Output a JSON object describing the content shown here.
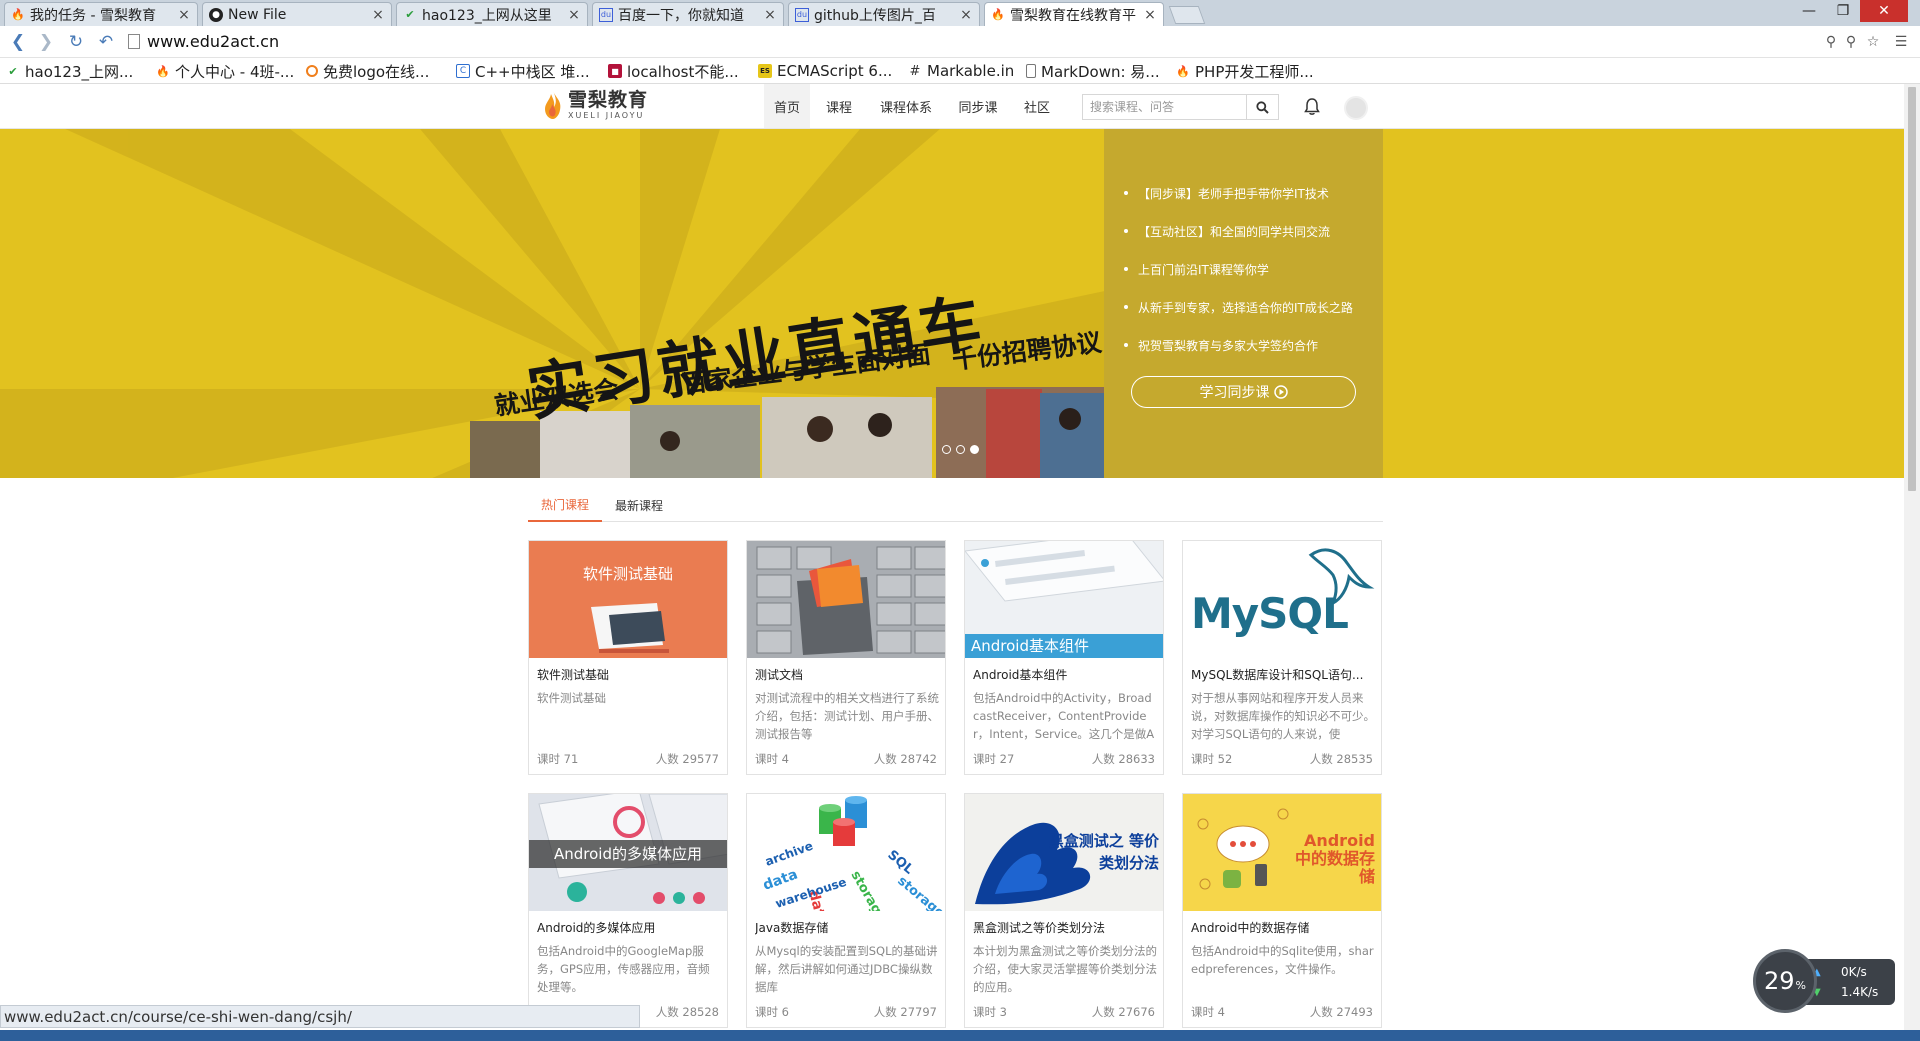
{
  "browser": {
    "tabs": [
      {
        "title": "我的任务 - 雪梨教育",
        "icon": "flame-icon"
      },
      {
        "title": "New File",
        "icon": "github-icon"
      },
      {
        "title": "hao123_上网从这里",
        "icon": "hao123-icon"
      },
      {
        "title": "百度一下，你就知道",
        "icon": "baidu-icon"
      },
      {
        "title": "github上传图片_百",
        "icon": "baidu-icon"
      },
      {
        "title": "雪梨教育在线教育平",
        "icon": "flame-icon"
      }
    ],
    "url": "www.edu2act.cn",
    "bookmarks": [
      {
        "label": "hao123_上网...",
        "icon": "hao123-icon",
        "color": "#2a9d3b"
      },
      {
        "label": "个人中心 - 4班-...",
        "icon": "flame-icon",
        "color": "#f08a1c"
      },
      {
        "label": "免费logo在线...",
        "icon": "logo-icon",
        "color": "#f07f1c"
      },
      {
        "label": "C++中栈区 堆...",
        "icon": "csdn-icon",
        "color": "#2f6fd0"
      },
      {
        "label": "localhost不能...",
        "icon": "stack-icon",
        "color": "#b3123a"
      },
      {
        "label": "ECMAScript 6...",
        "icon": "es-icon",
        "color": "#e6c619"
      },
      {
        "label": "Markable.in",
        "icon": "hash-icon",
        "color": "#333333"
      },
      {
        "label": "MarkDown: 易...",
        "icon": "page-icon",
        "color": "#777777"
      },
      {
        "label": "PHP开发工程师...",
        "icon": "flame-icon",
        "color": "#e0431c"
      }
    ],
    "status_url": "www.edu2act.cn/course/ce-shi-wen-dang/csjh/"
  },
  "site": {
    "logo_cn": "雪梨教育",
    "logo_en": "XUELI JIAOYU",
    "nav": [
      "首页",
      "课程",
      "课程体系",
      "同步课",
      "社区"
    ],
    "search_placeholder": "搜索课程、问答",
    "accent": "#e9673b"
  },
  "hero": {
    "headline": "实习就业直通车",
    "sub1": "就业双选会",
    "sub2": "百家企业与学生面对面",
    "sub3": "千份招聘协议",
    "list": [
      "【同步课】老师手把手带你学IT技术",
      "【互动社区】和全国的同学共同交流",
      "上百门前沿IT课程等你学",
      "从新手到专家，选择适合你的IT成长之路",
      "祝贺雪梨教育与多家大学签约合作"
    ],
    "button": "学习同步课",
    "bg_color": "#e2c21f",
    "panel_color": "#c5a92e"
  },
  "tabs": [
    "热门课程",
    "最新课程"
  ],
  "courses": [
    {
      "title": "软件测试基础",
      "desc": "软件测试基础",
      "lessons": "课时 71",
      "users": "人数 29577",
      "thumb_text": "软件测试基础"
    },
    {
      "title": "测试文档",
      "desc": "对测试流程中的相关文档进行了系统介绍，包括：测试计划、用户手册、测试报告等",
      "lessons": "课时 4",
      "users": "人数 28742",
      "thumb_text": ""
    },
    {
      "title": "Android基本组件",
      "desc": "包括Android中的Activity，BroadcastReceiver，ContentProvider，Intent，Service。这几个是做Andr",
      "lessons": "课时 27",
      "users": "人数 28633",
      "thumb_text": "Android基本组件"
    },
    {
      "title": "MySQL数据库设计和SQL语句...",
      "desc": "对于想从事网站和程序开发人员来说，对数据库操作的知识必不可少。对学习SQL语句的人来说，使",
      "lessons": "课时 52",
      "users": "人数 28535",
      "thumb_text": "MySQL"
    },
    {
      "title": "Android的多媒体应用",
      "desc": "包括Android中的GoogleMap服务，GPS应用，传感器应用，音频处理等。",
      "lessons": "",
      "users": "人数 28528",
      "thumb_text": "Android的多媒体应用"
    },
    {
      "title": "Java数据存储",
      "desc": "从Mysql的安装配置到SQL的基础讲解，然后讲解如何通过JDBC操纵数据库",
      "lessons": "课时 6",
      "users": "人数 27797",
      "thumb_text": ""
    },
    {
      "title": "黑盒测试之等价类划分法",
      "desc": "本计划为黑盒测试之等价类划分法的介绍，使大家灵活掌握等价类划分法的应用。",
      "lessons": "课时 3",
      "users": "人数 27676",
      "thumb_text": "黑盒测试之 等价类划分法"
    },
    {
      "title": "Android中的数据存储",
      "desc": "包括Android中的Sqlite使用，sharedpreferences，文件操作。",
      "lessons": "课时 4",
      "users": "人数 27493",
      "thumb_text": "Android 中的数据存储"
    }
  ],
  "net_widget": {
    "percent": "29",
    "unit": "%",
    "up": "0K/s",
    "down": "1.4K/s"
  }
}
